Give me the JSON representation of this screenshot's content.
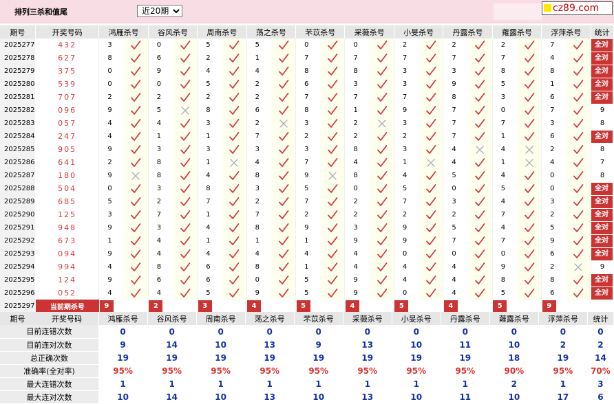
{
  "header": {
    "title": "排列三杀和值尾",
    "period_select": "近20期",
    "logo_text": "cz89.com"
  },
  "columns": [
    "期号",
    "开奖号码",
    "鸿雁杀号",
    "谷风杀号",
    "周南杀号",
    "荡之杀号",
    "芣苡杀号",
    "采薇杀号",
    "小旻杀号",
    "丹露杀号",
    "蕹露杀号",
    "浮萍杀号",
    "统计"
  ],
  "rows": [
    {
      "period": "2025277",
      "win": "432",
      "kills": [
        [
          "3",
          "ok"
        ],
        [
          "0",
          "ok"
        ],
        [
          "5",
          "ok"
        ],
        [
          "5",
          "ok"
        ],
        [
          "0",
          "ok"
        ],
        [
          "0",
          "ok"
        ],
        [
          "2",
          "ok"
        ],
        [
          "2",
          "ok"
        ],
        [
          "2",
          "ok"
        ],
        [
          "7",
          "ok"
        ]
      ],
      "stat": "全对"
    },
    {
      "period": "2025278",
      "win": "627",
      "kills": [
        [
          "8",
          "ok"
        ],
        [
          "6",
          "ok"
        ],
        [
          "2",
          "ok"
        ],
        [
          "1",
          "ok"
        ],
        [
          "7",
          "ok"
        ],
        [
          "7",
          "ok"
        ],
        [
          "7",
          "ok"
        ],
        [
          "7",
          "ok"
        ],
        [
          "7",
          "ok"
        ],
        [
          "4",
          "ok"
        ]
      ],
      "stat": "全对"
    },
    {
      "period": "2025279",
      "win": "375",
      "kills": [
        [
          "0",
          "ok"
        ],
        [
          "9",
          "ok"
        ],
        [
          "4",
          "ok"
        ],
        [
          "4",
          "ok"
        ],
        [
          "8",
          "ok"
        ],
        [
          "8",
          "ok"
        ],
        [
          "3",
          "ok"
        ],
        [
          "3",
          "ok"
        ],
        [
          "8",
          "ok"
        ],
        [
          "8",
          "ok"
        ]
      ],
      "stat": "全对"
    },
    {
      "period": "2025280",
      "win": "539",
      "kills": [
        [
          "0",
          "ok"
        ],
        [
          "0",
          "ok"
        ],
        [
          "5",
          "ok"
        ],
        [
          "2",
          "ok"
        ],
        [
          "6",
          "ok"
        ],
        [
          "3",
          "ok"
        ],
        [
          "3",
          "ok"
        ],
        [
          "9",
          "ok"
        ],
        [
          "5",
          "ok"
        ],
        [
          "1",
          "ok"
        ]
      ],
      "stat": "全对"
    },
    {
      "period": "2025281",
      "win": "707",
      "kills": [
        [
          "2",
          "ok"
        ],
        [
          "2",
          "ok"
        ],
        [
          "2",
          "ok"
        ],
        [
          "2",
          "ok"
        ],
        [
          "7",
          "ok"
        ],
        [
          "7",
          "ok"
        ],
        [
          "7",
          "ok"
        ],
        [
          "8",
          "ok"
        ],
        [
          "3",
          "ok"
        ],
        [
          "6",
          "ok"
        ]
      ],
      "stat": "全对"
    },
    {
      "period": "2025282",
      "win": "096",
      "kills": [
        [
          "9",
          "ok"
        ],
        [
          "5",
          "no"
        ],
        [
          "8",
          "ok"
        ],
        [
          "6",
          "ok"
        ],
        [
          "8",
          "ok"
        ],
        [
          "1",
          "ok"
        ],
        [
          "9",
          "ok"
        ],
        [
          "7",
          "ok"
        ],
        [
          "0",
          "ok"
        ],
        [
          "7",
          "ok"
        ]
      ],
      "stat": "9"
    },
    {
      "period": "2025283",
      "win": "057",
      "kills": [
        [
          "4",
          "ok"
        ],
        [
          "4",
          "ok"
        ],
        [
          "3",
          "ok"
        ],
        [
          "2",
          "no"
        ],
        [
          "3",
          "ok"
        ],
        [
          "2",
          "no"
        ],
        [
          "3",
          "ok"
        ],
        [
          "7",
          "ok"
        ],
        [
          "7",
          "ok"
        ],
        [
          "3",
          "ok"
        ]
      ],
      "stat": "8"
    },
    {
      "period": "2025284",
      "win": "247",
      "kills": [
        [
          "4",
          "ok"
        ],
        [
          "1",
          "ok"
        ],
        [
          "1",
          "ok"
        ],
        [
          "7",
          "ok"
        ],
        [
          "2",
          "ok"
        ],
        [
          "2",
          "ok"
        ],
        [
          "2",
          "ok"
        ],
        [
          "7",
          "ok"
        ],
        [
          "1",
          "ok"
        ],
        [
          "6",
          "ok"
        ]
      ],
      "stat": "全对"
    },
    {
      "period": "2025285",
      "win": "905",
      "kills": [
        [
          "9",
          "ok"
        ],
        [
          "3",
          "ok"
        ],
        [
          "3",
          "ok"
        ],
        [
          "3",
          "ok"
        ],
        [
          "3",
          "ok"
        ],
        [
          "8",
          "ok"
        ],
        [
          "3",
          "ok"
        ],
        [
          "4",
          "no"
        ],
        [
          "4",
          "no"
        ],
        [
          "2",
          "ok"
        ]
      ],
      "stat": "8"
    },
    {
      "period": "2025286",
      "win": "641",
      "kills": [
        [
          "2",
          "ok"
        ],
        [
          "8",
          "ok"
        ],
        [
          "1",
          "no"
        ],
        [
          "4",
          "ok"
        ],
        [
          "7",
          "ok"
        ],
        [
          "4",
          "ok"
        ],
        [
          "1",
          "no"
        ],
        [
          "4",
          "ok"
        ],
        [
          "1",
          "no"
        ],
        [
          "4",
          "ok"
        ]
      ],
      "stat": "7"
    },
    {
      "period": "2025287",
      "win": "180",
      "kills": [
        [
          "9",
          "no"
        ],
        [
          "8",
          "ok"
        ],
        [
          "4",
          "ok"
        ],
        [
          "8",
          "ok"
        ],
        [
          "9",
          "no"
        ],
        [
          "8",
          "ok"
        ],
        [
          "4",
          "ok"
        ],
        [
          "5",
          "ok"
        ],
        [
          "4",
          "ok"
        ],
        [
          "0",
          "ok"
        ]
      ],
      "stat": "8"
    },
    {
      "period": "2025288",
      "win": "504",
      "kills": [
        [
          "0",
          "ok"
        ],
        [
          "3",
          "ok"
        ],
        [
          "8",
          "ok"
        ],
        [
          "3",
          "ok"
        ],
        [
          "5",
          "ok"
        ],
        [
          "0",
          "ok"
        ],
        [
          "5",
          "ok"
        ],
        [
          "0",
          "ok"
        ],
        [
          "5",
          "ok"
        ],
        [
          "0",
          "ok"
        ]
      ],
      "stat": "全对"
    },
    {
      "period": "2025289",
      "win": "685",
      "kills": [
        [
          "5",
          "ok"
        ],
        [
          "2",
          "ok"
        ],
        [
          "7",
          "ok"
        ],
        [
          "2",
          "ok"
        ],
        [
          "7",
          "ok"
        ],
        [
          "2",
          "ok"
        ],
        [
          "7",
          "ok"
        ],
        [
          "3",
          "ok"
        ],
        [
          "4",
          "ok"
        ],
        [
          "3",
          "ok"
        ]
      ],
      "stat": "全对"
    },
    {
      "period": "2025290",
      "win": "125",
      "kills": [
        [
          "3",
          "ok"
        ],
        [
          "7",
          "ok"
        ],
        [
          "1",
          "ok"
        ],
        [
          "7",
          "ok"
        ],
        [
          "2",
          "ok"
        ],
        [
          "2",
          "ok"
        ],
        [
          "2",
          "ok"
        ],
        [
          "2",
          "ok"
        ],
        [
          "7",
          "ok"
        ],
        [
          "2",
          "ok"
        ]
      ],
      "stat": "全对"
    },
    {
      "period": "2025291",
      "win": "948",
      "kills": [
        [
          "9",
          "ok"
        ],
        [
          "3",
          "ok"
        ],
        [
          "4",
          "ok"
        ],
        [
          "8",
          "ok"
        ],
        [
          "9",
          "ok"
        ],
        [
          "3",
          "ok"
        ],
        [
          "9",
          "ok"
        ],
        [
          "5",
          "ok"
        ],
        [
          "4",
          "ok"
        ],
        [
          "5",
          "ok"
        ]
      ],
      "stat": "全对"
    },
    {
      "period": "2025292",
      "win": "673",
      "kills": [
        [
          "1",
          "ok"
        ],
        [
          "4",
          "ok"
        ],
        [
          "1",
          "ok"
        ],
        [
          "1",
          "ok"
        ],
        [
          "1",
          "ok"
        ],
        [
          "9",
          "ok"
        ],
        [
          "9",
          "ok"
        ],
        [
          "7",
          "ok"
        ],
        [
          "7",
          "ok"
        ],
        [
          "9",
          "ok"
        ]
      ],
      "stat": "全对"
    },
    {
      "period": "2025293",
      "win": "094",
      "kills": [
        [
          "9",
          "ok"
        ],
        [
          "4",
          "ok"
        ],
        [
          "4",
          "ok"
        ],
        [
          "4",
          "ok"
        ],
        [
          "4",
          "ok"
        ],
        [
          "4",
          "ok"
        ],
        [
          "0",
          "ok"
        ],
        [
          "0",
          "ok"
        ],
        [
          "0",
          "ok"
        ],
        [
          "6",
          "ok"
        ]
      ],
      "stat": "全对"
    },
    {
      "period": "2025294",
      "win": "994",
      "kills": [
        [
          "4",
          "ok"
        ],
        [
          "8",
          "ok"
        ],
        [
          "6",
          "ok"
        ],
        [
          "8",
          "ok"
        ],
        [
          "1",
          "ok"
        ],
        [
          "4",
          "ok"
        ],
        [
          "4",
          "ok"
        ],
        [
          "4",
          "ok"
        ],
        [
          "9",
          "ok"
        ],
        [
          "2",
          "no"
        ]
      ],
      "stat": "9"
    },
    {
      "period": "2025295",
      "win": "124",
      "kills": [
        [
          "9",
          "ok"
        ],
        [
          "6",
          "ok"
        ],
        [
          "6",
          "ok"
        ],
        [
          "0",
          "ok"
        ],
        [
          "5",
          "ok"
        ],
        [
          "9",
          "ok"
        ],
        [
          "4",
          "ok"
        ],
        [
          "4",
          "ok"
        ],
        [
          "8",
          "ok"
        ],
        [
          "8",
          "ok"
        ]
      ],
      "stat": "全对"
    },
    {
      "period": "2025296",
      "win": "052",
      "kills": [
        [
          "4",
          "ok"
        ],
        [
          "4",
          "ok"
        ],
        [
          "5",
          "ok"
        ],
        [
          "9",
          "ok"
        ],
        [
          "5",
          "ok"
        ],
        [
          "9",
          "ok"
        ],
        [
          "0",
          "ok"
        ],
        [
          "4",
          "ok"
        ],
        [
          "5",
          "ok"
        ],
        [
          "6",
          "ok"
        ]
      ],
      "stat": "全对"
    }
  ],
  "current": {
    "period": "2025297",
    "label": "当前期杀号",
    "kills": [
      "9",
      "2",
      "3",
      "4",
      "5",
      "4",
      "5",
      "4",
      "5",
      "9"
    ]
  },
  "summary": {
    "columns": [
      "期号",
      "开奖号码",
      "鸿雁杀号",
      "谷风杀号",
      "周南杀号",
      "荡之杀号",
      "芣苡杀号",
      "采薇杀号",
      "小旻杀号",
      "丹露杀号",
      "蕹露杀号",
      "浮萍杀号",
      "统计"
    ],
    "rows": [
      {
        "label": "目前连错次数",
        "values": [
          "0",
          "0",
          "0",
          "0",
          "0",
          "0",
          "0",
          "0",
          "0",
          "0",
          "0"
        ]
      },
      {
        "label": "目前连对次数",
        "values": [
          "9",
          "14",
          "10",
          "13",
          "9",
          "13",
          "10",
          "11",
          "10",
          "2",
          "2"
        ]
      },
      {
        "label": "总正确次数",
        "values": [
          "19",
          "19",
          "19",
          "19",
          "19",
          "19",
          "19",
          "19",
          "18",
          "19",
          "14"
        ]
      },
      {
        "label": "准确率(全对率)",
        "values": [
          "95%",
          "95%",
          "95%",
          "95%",
          "95%",
          "95%",
          "95%",
          "95%",
          "90%",
          "95%",
          "70%"
        ],
        "rate": true
      },
      {
        "label": "最大连错次数",
        "values": [
          "1",
          "1",
          "1",
          "1",
          "1",
          "1",
          "1",
          "1",
          "2",
          "1",
          "3"
        ]
      },
      {
        "label": "最大连对次数",
        "values": [
          "10",
          "14",
          "10",
          "13",
          "10",
          "13",
          "10",
          "11",
          "10",
          "17",
          "6"
        ]
      }
    ]
  },
  "colors": {
    "accent_red": "#cc3333",
    "check_red": "#d4393e",
    "cross_grey": "#aab0c0",
    "summary_blue": "#1133aa"
  }
}
